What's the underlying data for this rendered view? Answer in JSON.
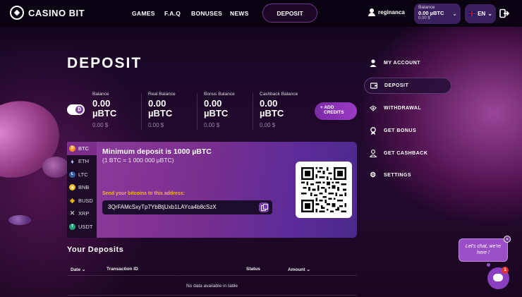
{
  "brand": {
    "name": "CASINO BIT"
  },
  "nav": {
    "items": [
      {
        "label": "GAMES"
      },
      {
        "label": "F.A.Q"
      },
      {
        "label": "BONUSES"
      },
      {
        "label": "NEWS"
      }
    ],
    "deposit_label": "DEPOSIT"
  },
  "user": {
    "username": "reginanca",
    "balance_label": "Balance",
    "balance_btc": "0.00 µBTC",
    "balance_usd": "0.00 $",
    "language": "EN"
  },
  "page": {
    "title": "DEPOSIT"
  },
  "stats": [
    {
      "label": "Balance",
      "value": "0.00",
      "unit": "µBTC",
      "usd": "0.00 $"
    },
    {
      "label": "Real Balance",
      "value": "0.00",
      "unit": "µBTC",
      "usd": "0.00 $"
    },
    {
      "label": "Bonus Balance",
      "value": "0.00",
      "unit": "µBTC",
      "usd": "0.00 $"
    },
    {
      "label": "Cashback Balance",
      "value": "0.00",
      "unit": "µBTC",
      "usd": "0.00 $"
    }
  ],
  "add_credits": {
    "line1": "+ ADD",
    "line2": "CREDITS"
  },
  "coins": [
    {
      "label": "BTC",
      "color": "#f7931a",
      "glyph": "₿",
      "active": true
    },
    {
      "label": "ETH",
      "color": "#627eea",
      "glyph": "◆",
      "active": false
    },
    {
      "label": "LTC",
      "color": "#345d9d",
      "glyph": "Ł",
      "active": false
    },
    {
      "label": "BNB",
      "color": "#f3ba2f",
      "glyph": "◆",
      "active": false
    },
    {
      "label": "BUSD",
      "color": "#f0b90b",
      "glyph": "◆",
      "active": false
    },
    {
      "label": "XRP",
      "color": "#23292f",
      "glyph": "✕",
      "active": false
    },
    {
      "label": "USDT",
      "color": "#26a17b",
      "glyph": "T",
      "active": false
    }
  ],
  "deposit": {
    "min_text": "Minimum deposit is 1000 µBTC",
    "rate_text": "(1 BTC = 1 000 000 µBTC)",
    "send_label": "Send your bitcoins to this address:",
    "address": "3QrFAMcSxyTp7YbBtjUxb1LAYca4b8cSzX"
  },
  "deposits": {
    "title": "Your Deposits",
    "columns": [
      {
        "label": "Date",
        "sortable": true
      },
      {
        "label": "Transaction ID",
        "sortable": false
      },
      {
        "label": "Status",
        "sortable": false
      },
      {
        "label": "Amount",
        "sortable": true
      }
    ],
    "empty_text": "No data available in table"
  },
  "side_menu": [
    {
      "label": "MY ACCOUNT",
      "icon": "user-icon",
      "active": false
    },
    {
      "label": "DEPOSIT",
      "icon": "wallet-icon",
      "active": true
    },
    {
      "label": "WITHDRAWAL",
      "icon": "cash-icon",
      "active": false
    },
    {
      "label": "GET BONUS",
      "icon": "medal-icon",
      "active": false
    },
    {
      "label": "GET CASHBACK",
      "icon": "user-cashback-icon",
      "active": false
    },
    {
      "label": "SETTINGS",
      "icon": "gear-icon",
      "active": false
    }
  ],
  "chat": {
    "line1": "Let's chat, we're",
    "line2": "here !",
    "badge": "1"
  }
}
